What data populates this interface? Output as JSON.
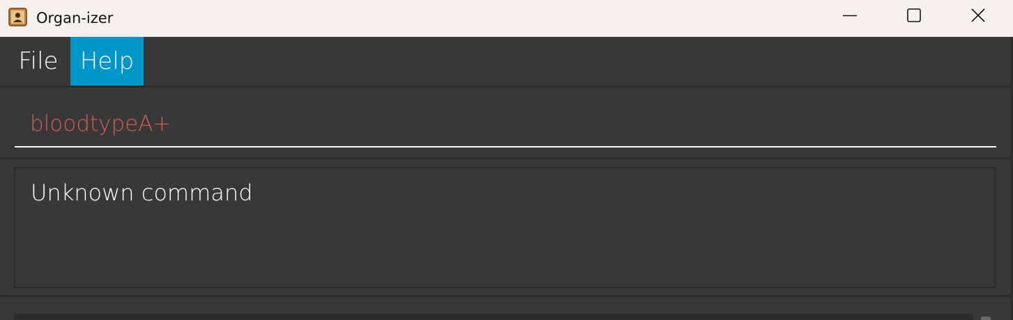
{
  "window": {
    "title": "Organ-izer",
    "icons": {
      "app": "address-book-icon",
      "minimize": "minimize-icon",
      "maximize": "maximize-icon",
      "close": "close-icon"
    }
  },
  "menu": {
    "items": [
      {
        "label": "File",
        "active": false
      },
      {
        "label": "Help",
        "active": true
      }
    ]
  },
  "command": {
    "value": "bloodtypeA+",
    "placeholder": ""
  },
  "result": {
    "text": "Unknown command"
  },
  "colors": {
    "titlebar_bg": "#f8f0ec",
    "app_bg": "#383838",
    "menu_active_bg": "#0096c9",
    "error_text": "#d25f4e"
  }
}
